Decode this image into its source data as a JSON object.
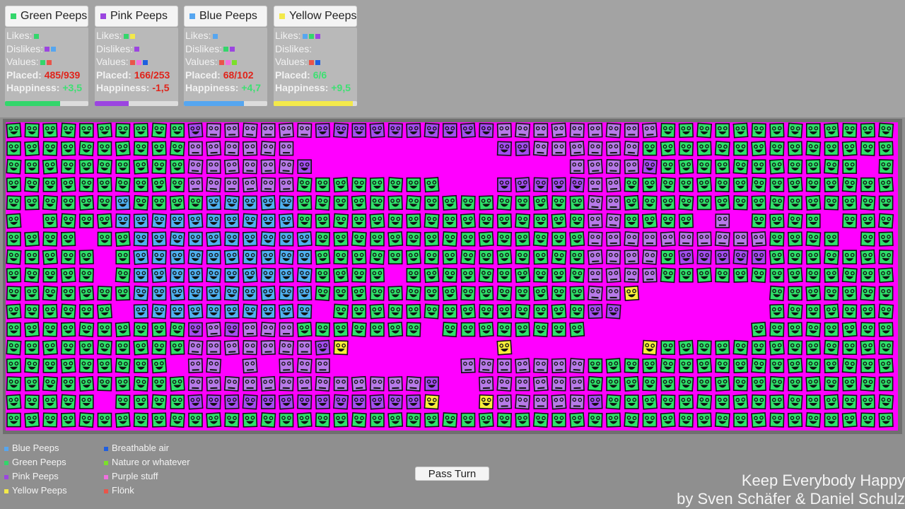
{
  "teams": [
    {
      "id": "green",
      "name": "Green Peeps",
      "color": "#33d66b",
      "likes": [
        "#33d66b"
      ],
      "dislikes": [
        "#9b45e0",
        "#56a6f0"
      ],
      "values": [
        "#33d66b",
        "#e9554a"
      ],
      "placed_label": "Placed:",
      "placed": "485/939",
      "placed_class": "red",
      "happiness_label": "Happiness:",
      "happiness": "+3,5",
      "happiness_class": "grn",
      "progress": 0.66,
      "likes_label": "Likes:",
      "dislikes_label": "Dislikes:",
      "values_label": "Values:"
    },
    {
      "id": "pink",
      "name": "Pink Peeps",
      "color": "#9b45e0",
      "likes": [
        "#33d66b",
        "#f3e94a"
      ],
      "dislikes": [
        "#9b45e0"
      ],
      "values": [
        "#e9554a",
        "#f070e0",
        "#1f5fe0"
      ],
      "placed_label": "Placed:",
      "placed": "166/253",
      "placed_class": "red",
      "happiness_label": "Happiness:",
      "happiness": "-1,5",
      "happiness_class": "red",
      "progress": 0.41,
      "likes_label": "Likes:",
      "dislikes_label": "Dislikes:",
      "values_label": "Values:"
    },
    {
      "id": "blue",
      "name": "Blue Peeps",
      "color": "#56a6f0",
      "likes": [
        "#56a6f0"
      ],
      "dislikes": [
        "#33d66b",
        "#9b45e0"
      ],
      "values": [
        "#e9554a",
        "#f070e0",
        "#7be02a"
      ],
      "placed_label": "Placed:",
      "placed": "68/102",
      "placed_class": "red",
      "happiness_label": "Happiness:",
      "happiness": "+4,7",
      "happiness_class": "grn",
      "progress": 0.72,
      "likes_label": "Likes:",
      "dislikes_label": "Dislikes:",
      "values_label": "Values:"
    },
    {
      "id": "yellow",
      "name": "Yellow Peeps",
      "color": "#f3e94a",
      "likes": [
        "#56a6f0",
        "#33d66b",
        "#9b45e0"
      ],
      "dislikes": [],
      "values": [
        "#e9554a",
        "#1f5fe0"
      ],
      "placed_label": "Placed:",
      "placed": "6/6",
      "placed_class": "grn",
      "happiness_label": "Happiness:",
      "happiness": "+9,5",
      "happiness_class": "grn",
      "progress": 0.95,
      "likes_label": "Likes:",
      "dislikes_label": "Dislikes:",
      "values_label": "Values:"
    }
  ],
  "legend": {
    "peeps": [
      {
        "label": "Blue Peeps",
        "color": "#56a6f0"
      },
      {
        "label": "Green Peeps",
        "color": "#33d66b"
      },
      {
        "label": "Pink Peeps",
        "color": "#9b45e0"
      },
      {
        "label": "Yellow Peeps",
        "color": "#f3e94a"
      }
    ],
    "resources": [
      {
        "label": "Breathable air",
        "color": "#1f5fe0"
      },
      {
        "label": "Nature or whatever",
        "color": "#7be02a"
      },
      {
        "label": "Purple stuff",
        "color": "#f070e0"
      },
      {
        "label": "Flönk",
        "color": "#e9554a"
      }
    ]
  },
  "pass_turn_label": "Pass Turn",
  "credits": {
    "title": "Keep Everybody Happy",
    "authors": "by Sven Schäfer & Daniel Schulz"
  },
  "board": {
    "background": "#ff00ff",
    "legend_chars": {
      "G": "green happy",
      "B": "blue happy",
      "P": "pink happy",
      "S": "pink sad",
      "Y": "yellow happy",
      ".": "empty"
    },
    "rows": [
      "GGGGGGGGGGPSSSSSSPPPPPPPPPPSSSSSSSSSGGGGGGGGGGGGG",
      "GGGGGGGGGGSSSSSS...........PPSSSSSSGGGGGGGGGGGGGG",
      "GGGGGGGGGGSSSSSSP..............SSSSPGGGGGGGGGGG.G",
      "GGGGGGGGGGSSSSSSGGGGGGGG...PPPPPSSGGGGGGGGGGGGGGG",
      "GGGGGGBGGGGBBBBBGGGGGGGGGGGGGGGGSSGGGGGGGGGGGGGGG",
      "G.GGGGBBBBBBBBBBGGGGGGGGGGGGGGGGSSGGGG.S.GGGG.GGG",
      "GGGG.GGBBBBBBBBBBGGGGGGGGGGGGGGGSSSSSSSSSSGGGG.GG",
      "GGGGG.GBBBBBBBBBBGGGGGGGGGGGGGGGSSSSGPPPPPGGGGGGG",
      "GGGGG.GBBBBBBBBBBGGGG.GGGGGGGGGGSSSSGGGGGGGGGGGGG",
      "GGGGGGGBBBBBBBBBBGGGGGGGGGGGGGGGSSY.......GGGGGGG",
      "GGGGGG.BBBBBBBBBB.GGGGGGGGGGGGGGPP........GGGGGGG",
      "GGGGGGGGGGPSPSSSGGGGGGG.GGGGGGGG.........GGGGGGGG",
      "GGGGGGGGGGSSSSSSSPY........Y.......YGGGGGGGGGGGGG",
      "GGGGGGGGG.SS.S.SSS.......SSSSSSSGGGGGGGGGGGGGGGGG",
      "GGGGGGGGGGSSSSSSSSSSSSSP..SSSSSSGGGGGGGGGGGGGGGGG",
      "GGGGG.GGGGPPPPPPPPPPPPPY..YSSSSSPGGGGGGGGGGGGGGGG",
      "GGGGGGGGGGGGGGGGGGGGGGGGGGGGGGGGGGGGGGGGGGGGGGGGG"
    ]
  }
}
